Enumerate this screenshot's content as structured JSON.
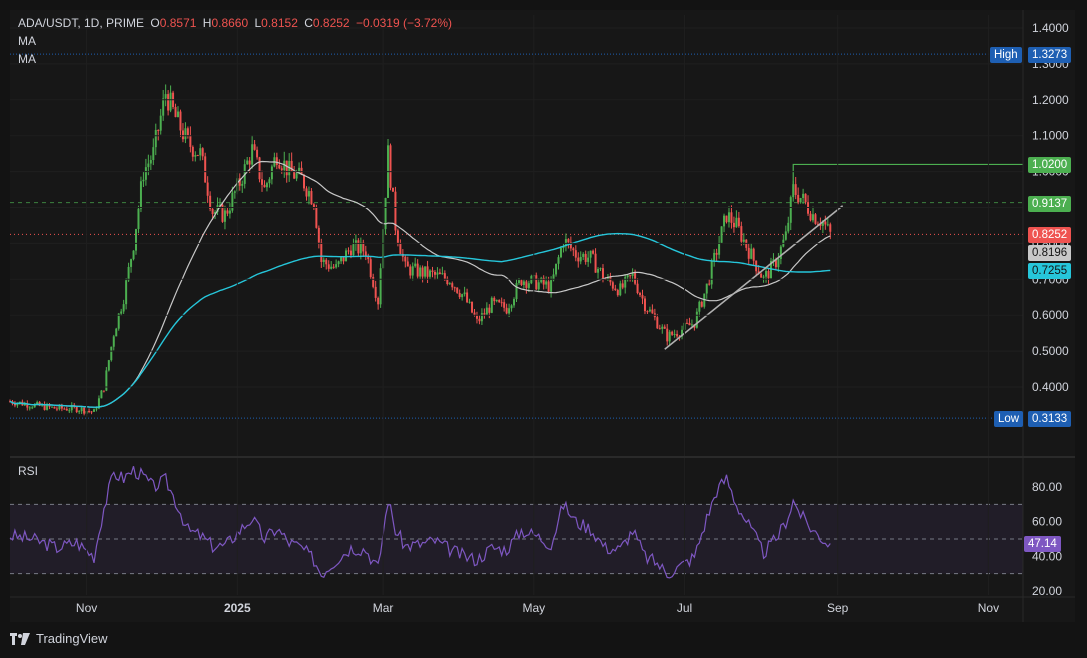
{
  "header": {
    "symbol": "ADA/USDT, 1D, PRIME",
    "o_label": "O",
    "o": "0.8571",
    "h_label": "H",
    "h": "0.8660",
    "l_label": "L",
    "l": "0.8152",
    "c_label": "C",
    "c": "0.8252",
    "change": "−0.0319 (−3.72%)",
    "ma1": "MA",
    "ma2": "MA"
  },
  "rsi_pane": {
    "title": "RSI",
    "value": "47.14"
  },
  "footer": {
    "brand": "TradingView"
  },
  "colors": {
    "background": "#131313",
    "up": "#26a69a",
    "up_candle": "#4caf50",
    "down": "#ef5350",
    "ma_fast": "#c8c8c8",
    "ma_slow": "#26c6da",
    "rsi": "#7e57c2",
    "high_low_badge": "#1e5fb3",
    "resistance": "#4caf50"
  },
  "chart_data": {
    "type": "candlestick",
    "price_axis": {
      "ticks": [
        "1.4000",
        "1.3000",
        "1.2000",
        "1.1000",
        "1.0000",
        "0.9000",
        "0.8000",
        "0.7000",
        "0.6000",
        "0.5000",
        "0.4000"
      ],
      "range": [
        0.28,
        1.45
      ]
    },
    "time_axis": {
      "ticks": [
        "Nov",
        "2025",
        "Mar",
        "May",
        "Jul",
        "Sep",
        "Nov"
      ]
    },
    "markers": {
      "high": {
        "label": "High",
        "value": "1.3273"
      },
      "low": {
        "label": "Low",
        "value": "0.3133"
      },
      "resistance": {
        "value": "1.0200"
      },
      "level": {
        "value": "0.9137"
      },
      "last": {
        "value": "0.8252"
      },
      "ma_fast": {
        "value": "0.8196"
      },
      "ma_slow": {
        "value": "0.7255"
      }
    },
    "price_path": [
      [
        "2024-10-01",
        0.36
      ],
      [
        "2024-10-10",
        0.35
      ],
      [
        "2024-10-20",
        0.34
      ],
      [
        "2024-10-28",
        0.34
      ],
      [
        "2024-11-04",
        0.33
      ],
      [
        "2024-11-08",
        0.4
      ],
      [
        "2024-11-12",
        0.55
      ],
      [
        "2024-11-16",
        0.65
      ],
      [
        "2024-11-20",
        0.8
      ],
      [
        "2024-11-24",
        1.0
      ],
      [
        "2024-11-28",
        1.05
      ],
      [
        "2024-12-03",
        1.22
      ],
      [
        "2024-12-07",
        1.15
      ],
      [
        "2024-12-12",
        1.08
      ],
      [
        "2024-12-17",
        1.05
      ],
      [
        "2024-12-22",
        0.89
      ],
      [
        "2024-12-27",
        0.88
      ],
      [
        "2025-01-02",
        0.97
      ],
      [
        "2025-01-07",
        1.06
      ],
      [
        "2025-01-12",
        0.95
      ],
      [
        "2025-01-17",
        1.05
      ],
      [
        "2025-01-22",
        1.0
      ],
      [
        "2025-01-27",
        0.98
      ],
      [
        "2025-02-01",
        0.92
      ],
      [
        "2025-02-04",
        0.75
      ],
      [
        "2025-02-10",
        0.73
      ],
      [
        "2025-02-16",
        0.79
      ],
      [
        "2025-02-22",
        0.78
      ],
      [
        "2025-02-27",
        0.64
      ],
      [
        "2025-03-03",
        1.05
      ],
      [
        "2025-03-06",
        0.85
      ],
      [
        "2025-03-10",
        0.73
      ],
      [
        "2025-03-16",
        0.72
      ],
      [
        "2025-03-22",
        0.71
      ],
      [
        "2025-03-28",
        0.7
      ],
      [
        "2025-04-03",
        0.65
      ],
      [
        "2025-04-08",
        0.58
      ],
      [
        "2025-04-14",
        0.63
      ],
      [
        "2025-04-20",
        0.62
      ],
      [
        "2025-04-26",
        0.7
      ],
      [
        "2025-05-02",
        0.69
      ],
      [
        "2025-05-08",
        0.68
      ],
      [
        "2025-05-13",
        0.81
      ],
      [
        "2025-05-18",
        0.77
      ],
      [
        "2025-05-24",
        0.76
      ],
      [
        "2025-05-30",
        0.7
      ],
      [
        "2025-06-05",
        0.67
      ],
      [
        "2025-06-10",
        0.71
      ],
      [
        "2025-06-15",
        0.63
      ],
      [
        "2025-06-20",
        0.58
      ],
      [
        "2025-06-24",
        0.54
      ],
      [
        "2025-06-30",
        0.56
      ],
      [
        "2025-07-05",
        0.58
      ],
      [
        "2025-07-10",
        0.68
      ],
      [
        "2025-07-14",
        0.78
      ],
      [
        "2025-07-18",
        0.88
      ],
      [
        "2025-07-22",
        0.85
      ],
      [
        "2025-07-27",
        0.78
      ],
      [
        "2025-08-02",
        0.7
      ],
      [
        "2025-08-07",
        0.75
      ],
      [
        "2025-08-11",
        0.82
      ],
      [
        "2025-08-14",
        0.95
      ],
      [
        "2025-08-18",
        0.92
      ],
      [
        "2025-08-22",
        0.88
      ],
      [
        "2025-08-26",
        0.86
      ],
      [
        "2025-08-29",
        0.825
      ]
    ],
    "rsi": {
      "ticks": [
        "80.00",
        "60.00",
        "40.00",
        "20.00"
      ],
      "bands": [
        70,
        50,
        30
      ],
      "range": [
        18,
        95
      ],
      "path": [
        [
          "2024-10-01",
          52
        ],
        [
          "2024-10-10",
          50
        ],
        [
          "2024-10-20",
          45
        ],
        [
          "2024-10-28",
          48
        ],
        [
          "2024-11-04",
          40
        ],
        [
          "2024-11-08",
          68
        ],
        [
          "2024-11-12",
          88
        ],
        [
          "2024-11-16",
          85
        ],
        [
          "2024-11-20",
          90
        ],
        [
          "2024-11-24",
          86
        ],
        [
          "2024-11-28",
          80
        ],
        [
          "2024-12-03",
          84
        ],
        [
          "2024-12-07",
          72
        ],
        [
          "2024-12-12",
          55
        ],
        [
          "2024-12-17",
          52
        ],
        [
          "2024-12-22",
          46
        ],
        [
          "2024-12-27",
          46
        ],
        [
          "2025-01-02",
          55
        ],
        [
          "2025-01-07",
          62
        ],
        [
          "2025-01-12",
          50
        ],
        [
          "2025-01-17",
          56
        ],
        [
          "2025-01-22",
          48
        ],
        [
          "2025-01-27",
          45
        ],
        [
          "2025-02-01",
          38
        ],
        [
          "2025-02-04",
          30
        ],
        [
          "2025-02-10",
          38
        ],
        [
          "2025-02-16",
          45
        ],
        [
          "2025-02-22",
          44
        ],
        [
          "2025-02-27",
          33
        ],
        [
          "2025-03-03",
          73
        ],
        [
          "2025-03-06",
          55
        ],
        [
          "2025-03-10",
          46
        ],
        [
          "2025-03-16",
          47
        ],
        [
          "2025-03-22",
          49
        ],
        [
          "2025-03-28",
          44
        ],
        [
          "2025-04-03",
          40
        ],
        [
          "2025-04-08",
          38
        ],
        [
          "2025-04-14",
          45
        ],
        [
          "2025-04-20",
          44
        ],
        [
          "2025-04-26",
          55
        ],
        [
          "2025-05-02",
          52
        ],
        [
          "2025-05-08",
          47
        ],
        [
          "2025-05-13",
          70
        ],
        [
          "2025-05-18",
          60
        ],
        [
          "2025-05-24",
          56
        ],
        [
          "2025-05-30",
          45
        ],
        [
          "2025-06-05",
          44
        ],
        [
          "2025-06-10",
          55
        ],
        [
          "2025-06-15",
          40
        ],
        [
          "2025-06-20",
          36
        ],
        [
          "2025-06-24",
          30
        ],
        [
          "2025-06-30",
          35
        ],
        [
          "2025-07-05",
          40
        ],
        [
          "2025-07-10",
          62
        ],
        [
          "2025-07-14",
          78
        ],
        [
          "2025-07-18",
          85
        ],
        [
          "2025-07-22",
          70
        ],
        [
          "2025-07-27",
          58
        ],
        [
          "2025-08-02",
          42
        ],
        [
          "2025-08-07",
          50
        ],
        [
          "2025-08-11",
          60
        ],
        [
          "2025-08-14",
          72
        ],
        [
          "2025-08-18",
          62
        ],
        [
          "2025-08-22",
          55
        ],
        [
          "2025-08-26",
          50
        ],
        [
          "2025-08-29",
          47
        ]
      ]
    }
  }
}
